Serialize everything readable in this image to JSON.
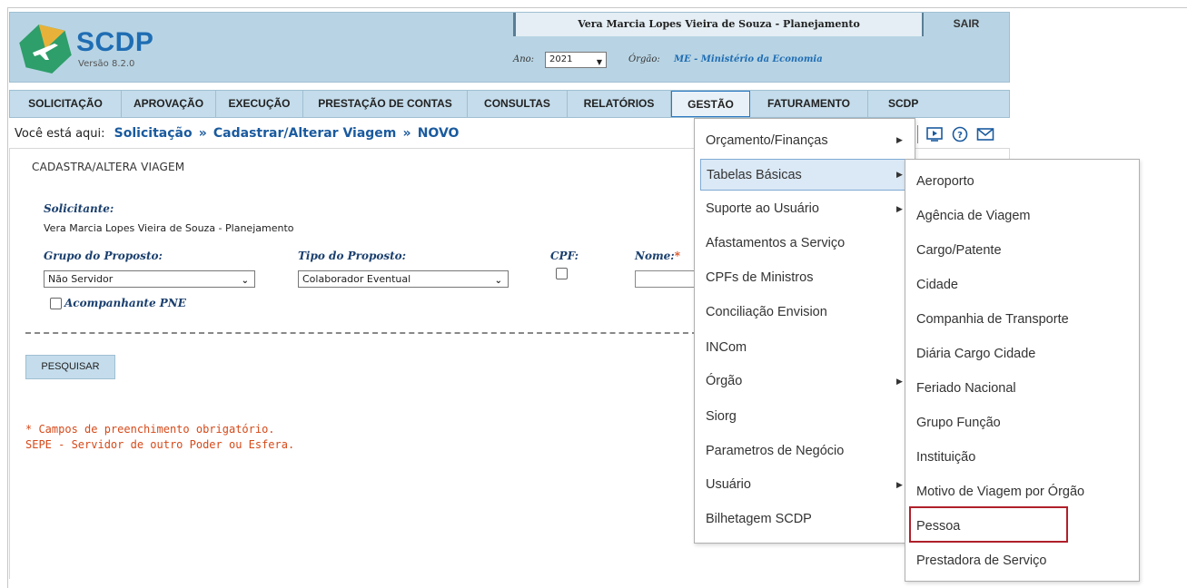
{
  "header": {
    "app_name": "SCDP",
    "version": "Versão 8.2.0",
    "user": "Vera Marcia Lopes Vieira de Souza - Planejamento",
    "logout": "SAIR",
    "ano_label": "Ano:",
    "ano_value": "2021",
    "orgao_label": "Órgão:",
    "orgao_value": "ME - Ministério da Economia"
  },
  "nav": {
    "items": [
      {
        "label": "SOLICITAÇÃO"
      },
      {
        "label": "APROVAÇÃO"
      },
      {
        "label": "EXECUÇÃO"
      },
      {
        "label": "PRESTAÇÃO DE CONTAS"
      },
      {
        "label": "CONSULTAS"
      },
      {
        "label": "RELATÓRIOS"
      },
      {
        "label": "GESTÃO"
      },
      {
        "label": "FATURAMENTO"
      },
      {
        "label": "SCDP"
      }
    ],
    "active": "GESTÃO"
  },
  "breadcrumb": {
    "prefix": "Você está aqui:",
    "items": [
      "Solicitação",
      "Cadastrar/Alterar Viagem",
      "NOVO"
    ],
    "separator": "»"
  },
  "form": {
    "title": "CADASTRA/ALTERA VIAGEM",
    "solicitante_label": "Solicitante:",
    "solicitante_value": "Vera Marcia Lopes Vieira de Souza - Planejamento",
    "grupo_label": "Grupo do Proposto:",
    "grupo_value": "Não Servidor",
    "tipo_label": "Tipo do Proposto:",
    "tipo_value": "Colaborador Eventual",
    "cpf_label": "CPF:",
    "nome_label": "Nome:",
    "required_mark": "*",
    "acompanhante_label": "Acompanhante PNE",
    "search_button": "PESQUISAR",
    "note_required": "* Campos de preenchimento obrigatório.",
    "note_sepe": "SEPE - Servidor de outro Poder ou Esfera."
  },
  "gestao_menu": {
    "items": [
      {
        "label": "Orçamento/Finanças",
        "submenu": true
      },
      {
        "label": "Tabelas Básicas",
        "submenu": true
      },
      {
        "label": "Suporte ao Usuário",
        "submenu": true
      },
      {
        "label": "Afastamentos a Serviço",
        "submenu": false
      },
      {
        "label": "CPFs de Ministros",
        "submenu": false
      },
      {
        "label": "Conciliação Envision",
        "submenu": false
      },
      {
        "label": "INCom",
        "submenu": false
      },
      {
        "label": "Órgão",
        "submenu": true
      },
      {
        "label": "Siorg",
        "submenu": false
      },
      {
        "label": "Parametros de Negócio",
        "submenu": false
      },
      {
        "label": "Usuário",
        "submenu": true
      },
      {
        "label": "Bilhetagem SCDP",
        "submenu": false
      }
    ],
    "highlighted": "Tabelas Básicas"
  },
  "tabelas_submenu": {
    "items": [
      "Aeroporto",
      "Agência de Viagem",
      "Cargo/Patente",
      "Cidade",
      "Companhia de Transporte",
      "Diária Cargo Cidade",
      "Feriado Nacional",
      "Grupo Função",
      "Instituição",
      "Motivo de Viagem por Órgão",
      "Pessoa",
      "Prestadora de Serviço"
    ],
    "highlighted": "Pessoa"
  },
  "colors": {
    "header_bg": "#b8d4e4",
    "nav_bg": "#c4dceb",
    "brand_blue": "#1f6db3",
    "required_red": "#d64a1a",
    "logo_green": "#2e9e6a"
  }
}
